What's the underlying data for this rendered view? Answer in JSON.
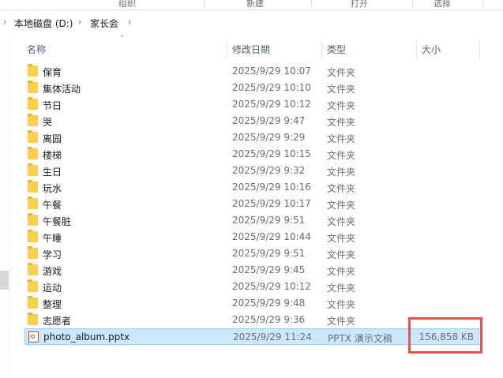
{
  "ribbon": {
    "groups": [
      "组织",
      "新建",
      "打开",
      "选择"
    ]
  },
  "breadcrumb": {
    "drive": "本地磁盘 (D:)",
    "folder": "家长会"
  },
  "columns": {
    "name": "名称",
    "modified": "修改日期",
    "type": "类型",
    "size": "大小"
  },
  "files": [
    {
      "name": "保育",
      "modified": "2025/9/29 10:07",
      "type": "文件夹",
      "size": "",
      "icon": "folder-icon"
    },
    {
      "name": "集体活动",
      "modified": "2025/9/29 10:10",
      "type": "文件夹",
      "size": "",
      "icon": "folder-icon"
    },
    {
      "name": "节日",
      "modified": "2025/9/29 10:12",
      "type": "文件夹",
      "size": "",
      "icon": "folder-icon"
    },
    {
      "name": "哭",
      "modified": "2025/9/29 9:47",
      "type": "文件夹",
      "size": "",
      "icon": "folder-icon"
    },
    {
      "name": "离园",
      "modified": "2025/9/29 9:29",
      "type": "文件夹",
      "size": "",
      "icon": "folder-icon"
    },
    {
      "name": "楼梯",
      "modified": "2025/9/29 10:15",
      "type": "文件夹",
      "size": "",
      "icon": "folder-icon"
    },
    {
      "name": "生日",
      "modified": "2025/9/29 9:32",
      "type": "文件夹",
      "size": "",
      "icon": "folder-icon"
    },
    {
      "name": "玩水",
      "modified": "2025/9/29 10:16",
      "type": "文件夹",
      "size": "",
      "icon": "folder-icon"
    },
    {
      "name": "午餐",
      "modified": "2025/9/29 10:17",
      "type": "文件夹",
      "size": "",
      "icon": "folder-icon"
    },
    {
      "name": "午餐脏",
      "modified": "2025/9/29 9:51",
      "type": "文件夹",
      "size": "",
      "icon": "folder-icon"
    },
    {
      "name": "午睡",
      "modified": "2025/9/29 10:44",
      "type": "文件夹",
      "size": "",
      "icon": "folder-icon"
    },
    {
      "name": "学习",
      "modified": "2025/9/29 9:51",
      "type": "文件夹",
      "size": "",
      "icon": "folder-icon"
    },
    {
      "name": "游戏",
      "modified": "2025/9/29 9:45",
      "type": "文件夹",
      "size": "",
      "icon": "folder-icon"
    },
    {
      "name": "运动",
      "modified": "2025/9/29 10:12",
      "type": "文件夹",
      "size": "",
      "icon": "folder-icon"
    },
    {
      "name": "整理",
      "modified": "2025/9/29 9:48",
      "type": "文件夹",
      "size": "",
      "icon": "folder-icon"
    },
    {
      "name": "志愿者",
      "modified": "2025/9/29 9:36",
      "type": "文件夹",
      "size": "",
      "icon": "folder-icon"
    },
    {
      "name": "photo_album.pptx",
      "modified": "2025/9/29 11:24",
      "type": "PPTX 演示文稿",
      "size": "156,858 KB",
      "icon": "pptx-file-icon",
      "selected": true
    }
  ],
  "colors": {
    "selection": "#cce8ff",
    "highlight": "#e8534f",
    "folder": "#ffcf4a"
  }
}
